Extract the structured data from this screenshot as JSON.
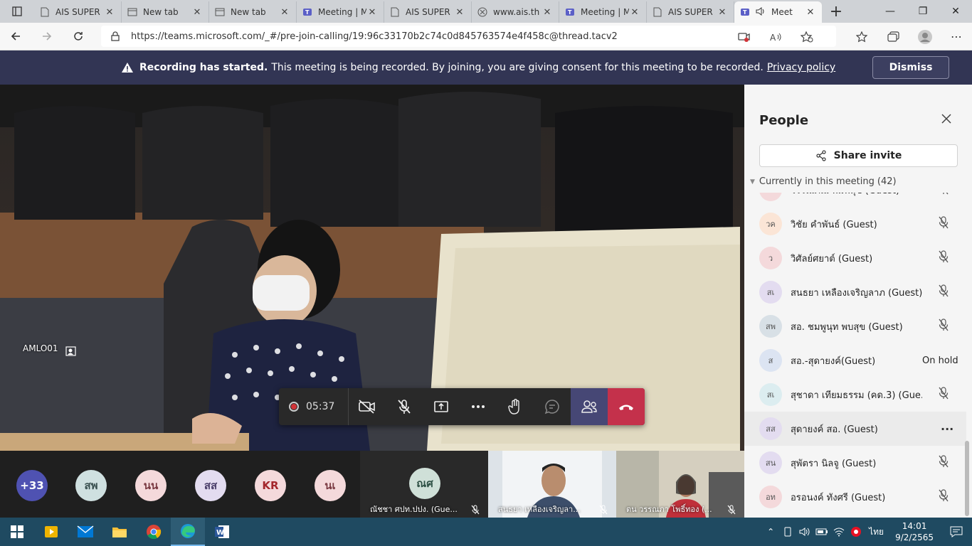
{
  "browser": {
    "tabs": [
      {
        "label": "AIS SUPER",
        "icon": "doc-icon",
        "active": false
      },
      {
        "label": "New tab",
        "icon": "newtab-icon",
        "active": false
      },
      {
        "label": "New tab",
        "icon": "newtab-icon",
        "active": false
      },
      {
        "label": "Meeting | M",
        "icon": "teams-icon",
        "active": false
      },
      {
        "label": "AIS SUPER",
        "icon": "doc-icon",
        "active": false
      },
      {
        "label": "www.ais.th",
        "icon": "page-icon",
        "active": false
      },
      {
        "label": "Meeting | M",
        "icon": "teams-icon",
        "active": false
      },
      {
        "label": "AIS SUPER",
        "icon": "doc-icon",
        "active": false
      },
      {
        "label": "Meet",
        "icon": "teams-icon",
        "active": true
      }
    ],
    "url": "https://teams.microsoft.com/_#/pre-join-calling/19:96c33170b2c74c0d845763574e4f458c@thread.tacv2"
  },
  "banner": {
    "title": "Recording has started.",
    "message": "This meeting is being recorded. By joining, you are giving consent for this meeting to be recorded.",
    "link": "Privacy policy",
    "dismiss_label": "Dismiss"
  },
  "video": {
    "label": "AMLO01"
  },
  "callbar": {
    "timer": "05:37"
  },
  "gallery": {
    "avatars": [
      {
        "initials": "+33",
        "color": "#4f52b2",
        "text_color": "#ffffff"
      },
      {
        "initials": "สพ",
        "color": "#cfe0e0",
        "text_color": "#3a5050"
      },
      {
        "initials": "นน",
        "color": "#f4d9db",
        "text_color": "#7a3a42"
      },
      {
        "initials": "สส",
        "color": "#e3dcf0",
        "text_color": "#4b3f6a"
      },
      {
        "initials": "KR",
        "color": "#f4d9db",
        "text_color": "#a4262c"
      },
      {
        "initials": "นเ",
        "color": "#f4d9db",
        "text_color": "#7a3a42"
      }
    ],
    "tiles": [
      {
        "initials": "ณศ",
        "name": "ณัชชา ศปท.ปปง. (Gue..."
      },
      {
        "name": "สนธยา เหลืองเจริญลา..."
      },
      {
        "name": "ตน วรรณภา โพธิ์ทอง (..."
      }
    ]
  },
  "people_panel": {
    "title": "People",
    "share_label": "Share invite",
    "section_label": "Currently in this meeting",
    "section_count": "(42)",
    "participants": [
      {
        "initials": "สเ",
        "name": "วรรณิภณ พิมพ์สุข (Guest)",
        "status": "muted",
        "color": "#f4d9db"
      },
      {
        "initials": "วค",
        "name": "วิชัย คำพันธ์ (Guest)",
        "status": "muted",
        "color": "#fbe5d6"
      },
      {
        "initials": "ว",
        "name": "วิศัลย์ศยาต์ (Guest)",
        "status": "muted",
        "color": "#f4d9db"
      },
      {
        "initials": "สเ",
        "name": "สนธยา เหลืองเจริญลาภ (Guest)",
        "status": "muted",
        "color": "#e3dcf0"
      },
      {
        "initials": "สพ",
        "name": "สอ. ชมพูนุท พบสุข (Guest)",
        "status": "muted",
        "color": "#d8e0e6"
      },
      {
        "initials": "ส",
        "name": "สอ.-สุดายงค์(Guest)",
        "status": "On hold",
        "color": "#dce4f2"
      },
      {
        "initials": "สเ",
        "name": "สุชาดา เทียมธรรม (คด.3) (Gue...",
        "status": "muted",
        "color": "#dcedf0"
      },
      {
        "initials": "สส",
        "name": "สุดายงค์ สอ. (Guest)",
        "status": "more",
        "color": "#e3dcf0"
      },
      {
        "initials": "สน",
        "name": "สุพัตรา นิลจู (Guest)",
        "status": "muted",
        "color": "#e3dcf0"
      },
      {
        "initials": "อท",
        "name": "อรอนงค์ ทังศรี (Guest)",
        "status": "muted",
        "color": "#f4d9db"
      }
    ]
  },
  "taskbar": {
    "apps": [
      "start-icon",
      "media-icon",
      "mail-icon",
      "explorer-icon",
      "chrome-icon",
      "edge-icon",
      "word-icon"
    ],
    "language": "ไทย",
    "time": "14:01",
    "date": "9/2/2565"
  }
}
